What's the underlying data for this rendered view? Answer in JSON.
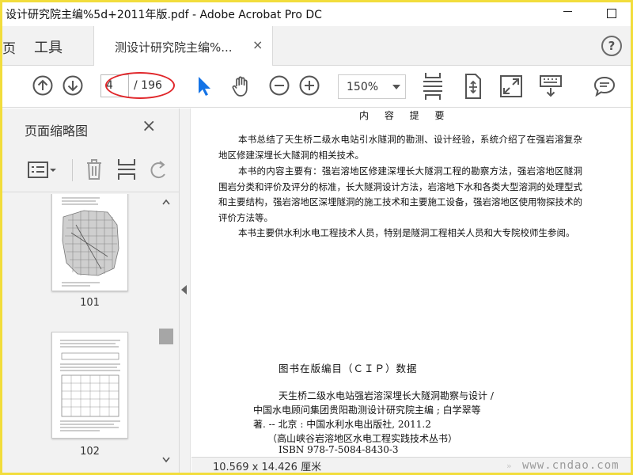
{
  "window": {
    "title": "设计研究院主编%5d+2011年版.pdf - Adobe Acrobat Pro DC"
  },
  "menu": {
    "home_tab": "页",
    "tools_tab": "工具",
    "doc_tab": "测设计研究院主编%...",
    "doc_tab_close": "×",
    "help": "?"
  },
  "toolbar": {
    "page_number": "4",
    "page_total": "/ 196",
    "zoom": "150%",
    "highlight_color": "#e0262a",
    "icons": [
      "prev-page-icon",
      "next-page-icon",
      "select-cursor-icon",
      "hand-tool-icon",
      "zoom-out-icon",
      "zoom-in-icon",
      "scroll-mode-icon",
      "rotate-view-icon",
      "full-screen-icon",
      "keyboard-icon",
      "comment-icon"
    ],
    "accent": "#1473e6"
  },
  "thumbnails": {
    "pane_title": "页面缩略图",
    "close": "×",
    "pages": [
      {
        "label": "101"
      },
      {
        "label": "102"
      }
    ]
  },
  "document": {
    "heading": "内 容 提 要",
    "paragraphs": [
      "本书总结了天生桥二级水电站引水隧洞的勘测、设计经验，系统介绍了在强岩溶复杂地区修建深埋长大隧洞的相关技术。",
      "本书的内容主要有：强岩溶地区修建深埋长大隧洞工程的勘察方法，强岩溶地区隧洞围岩分类和评价及评分的标准，长大隧洞设计方法，岩溶地下水和各类大型溶洞的处理型式和主要结构，强岩溶地区深埋隧洞的施工技术和主要施工设备，强岩溶地区使用物探技术的评价方法等。",
      "本书主要供水利水电工程技术人员，特别是隧洞工程相关人员和大专院校师生参阅。"
    ],
    "cip_title": "图书在版编目（ＣＩＰ）数据",
    "cip_lines": [
      "天生桥二级水电站强岩溶深埋长大隧洞勘察与设计 /",
      "中国水电顾问集团贵阳勘测设计研究院主编 ; 白学翠等",
      "著. -- 北京 : 中国水利水电出版社, 2011.2",
      "（高山峡谷岩溶地区水电工程实践技术丛书）",
      "ISBN 978-7-5084-8430-3"
    ]
  },
  "status": {
    "page_dimensions": "10.569 x 14.426 厘米",
    "watermark": "www.cndao.com"
  }
}
